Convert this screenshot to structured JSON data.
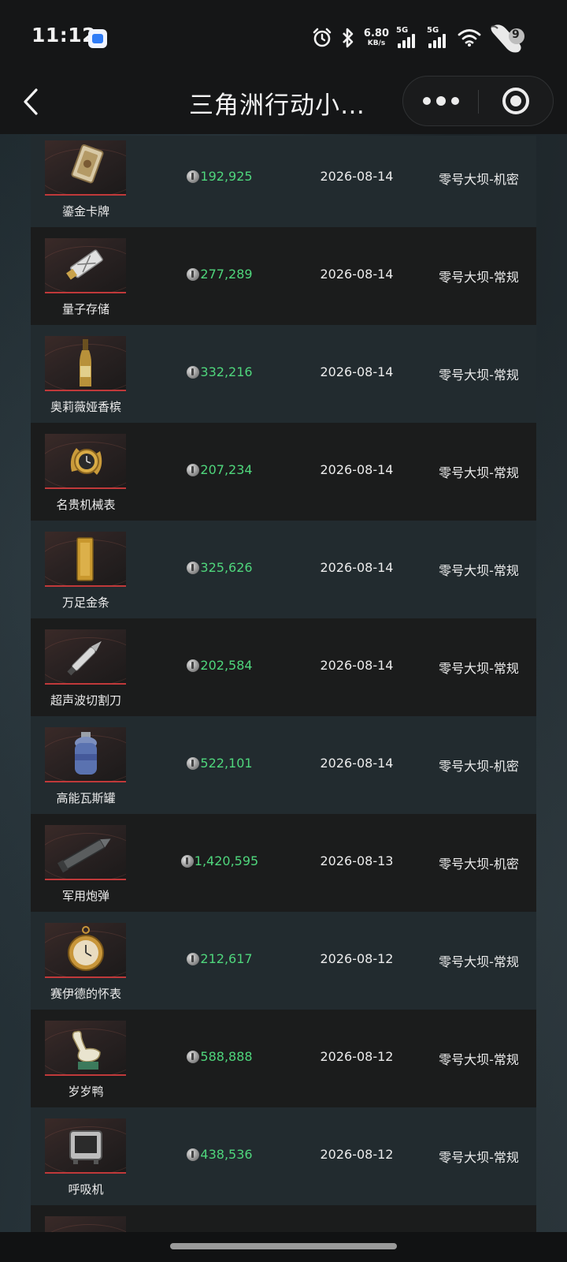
{
  "status_bar": {
    "time": "11:12",
    "net_speed_value": "6.80",
    "net_speed_unit": "KB/s",
    "sim1": "5G",
    "sim2": "5G",
    "battery": "9",
    "icons": [
      "app-notification-icon",
      "alarm-icon",
      "bluetooth-icon",
      "signal-icon",
      "wifi-icon",
      "battery-icon"
    ]
  },
  "header": {
    "title": "三角洲行动小…",
    "more_icon": "more-dots-icon",
    "close_icon": "target-close-icon",
    "back_icon": "chevron-left-icon"
  },
  "colors": {
    "price_green": "#4fd67c",
    "row_odd": "#222b2f",
    "row_even": "#1b1c1c",
    "thumb_accent": "#c0393a"
  },
  "records": [
    {
      "name": "鎏金卡牌",
      "price": "192,925",
      "date": "2026-08-14",
      "map": "零号大坝-机密",
      "icon": "gilded-card-icon"
    },
    {
      "name": "量子存储",
      "price": "277,289",
      "date": "2026-08-14",
      "map": "零号大坝-常规",
      "icon": "quantum-storage-icon"
    },
    {
      "name": "奥莉薇娅香槟",
      "price": "332,216",
      "date": "2026-08-14",
      "map": "零号大坝-常规",
      "icon": "champagne-bottle-icon"
    },
    {
      "name": "名贵机械表",
      "price": "207,234",
      "date": "2026-08-14",
      "map": "零号大坝-常规",
      "icon": "luxury-watch-icon"
    },
    {
      "name": "万足金条",
      "price": "325,626",
      "date": "2026-08-14",
      "map": "零号大坝-常规",
      "icon": "gold-bar-icon"
    },
    {
      "name": "超声波切割刀",
      "price": "202,584",
      "date": "2026-08-14",
      "map": "零号大坝-常规",
      "icon": "ultrasonic-knife-icon"
    },
    {
      "name": "高能瓦斯罐",
      "price": "522,101",
      "date": "2026-08-14",
      "map": "零号大坝-机密",
      "icon": "gas-canister-icon"
    },
    {
      "name": "军用炮弹",
      "price": "1,420,595",
      "date": "2026-08-13",
      "map": "零号大坝-机密",
      "icon": "artillery-shell-icon"
    },
    {
      "name": "赛伊德的怀表",
      "price": "212,617",
      "date": "2026-08-12",
      "map": "零号大坝-常规",
      "icon": "pocket-watch-icon"
    },
    {
      "name": "岁岁鸭",
      "price": "588,888",
      "date": "2026-08-12",
      "map": "零号大坝-常规",
      "icon": "duck-ornament-icon"
    },
    {
      "name": "呼吸机",
      "price": "438,536",
      "date": "2026-08-12",
      "map": "零号大坝-常规",
      "icon": "respirator-icon"
    },
    {
      "name": "",
      "price": "",
      "date": "",
      "map": "",
      "icon": "partial-item-icon"
    }
  ]
}
